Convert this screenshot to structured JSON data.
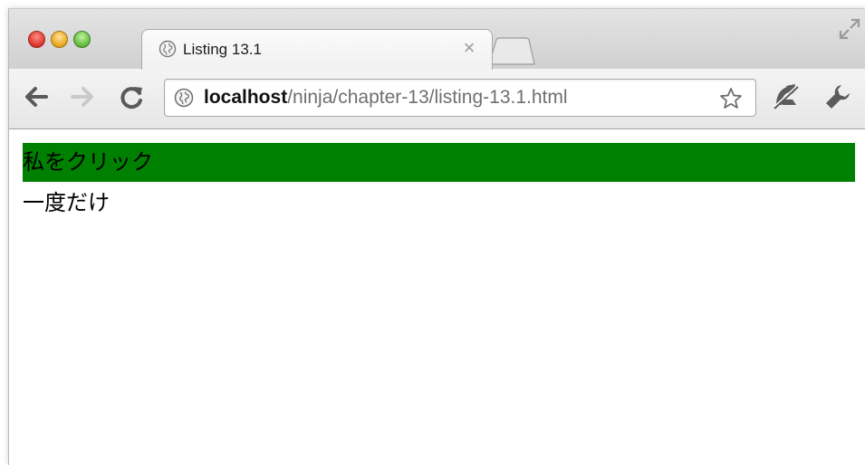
{
  "browser": {
    "tab": {
      "title": "Listing 13.1",
      "close_symbol": "×",
      "favicon": "globe-icon"
    },
    "new_tab_icon": "new-tab-icon",
    "window_controls": [
      "close-button",
      "minimize-button",
      "zoom-button"
    ],
    "toolbar": {
      "back_icon": "back-arrow-icon",
      "forward_icon": "forward-arrow-icon",
      "reload_icon": "reload-icon",
      "url_host": "localhost",
      "url_path": "/ninja/chapter-13/listing-13.1.html",
      "bookmark_icon": "star-icon",
      "extension_icon": "extension-icon",
      "menu_icon": "wrench-icon"
    }
  },
  "page": {
    "click_box_text": "私をクリック",
    "click_box_color": "#008000",
    "once_text": "一度だけ"
  }
}
